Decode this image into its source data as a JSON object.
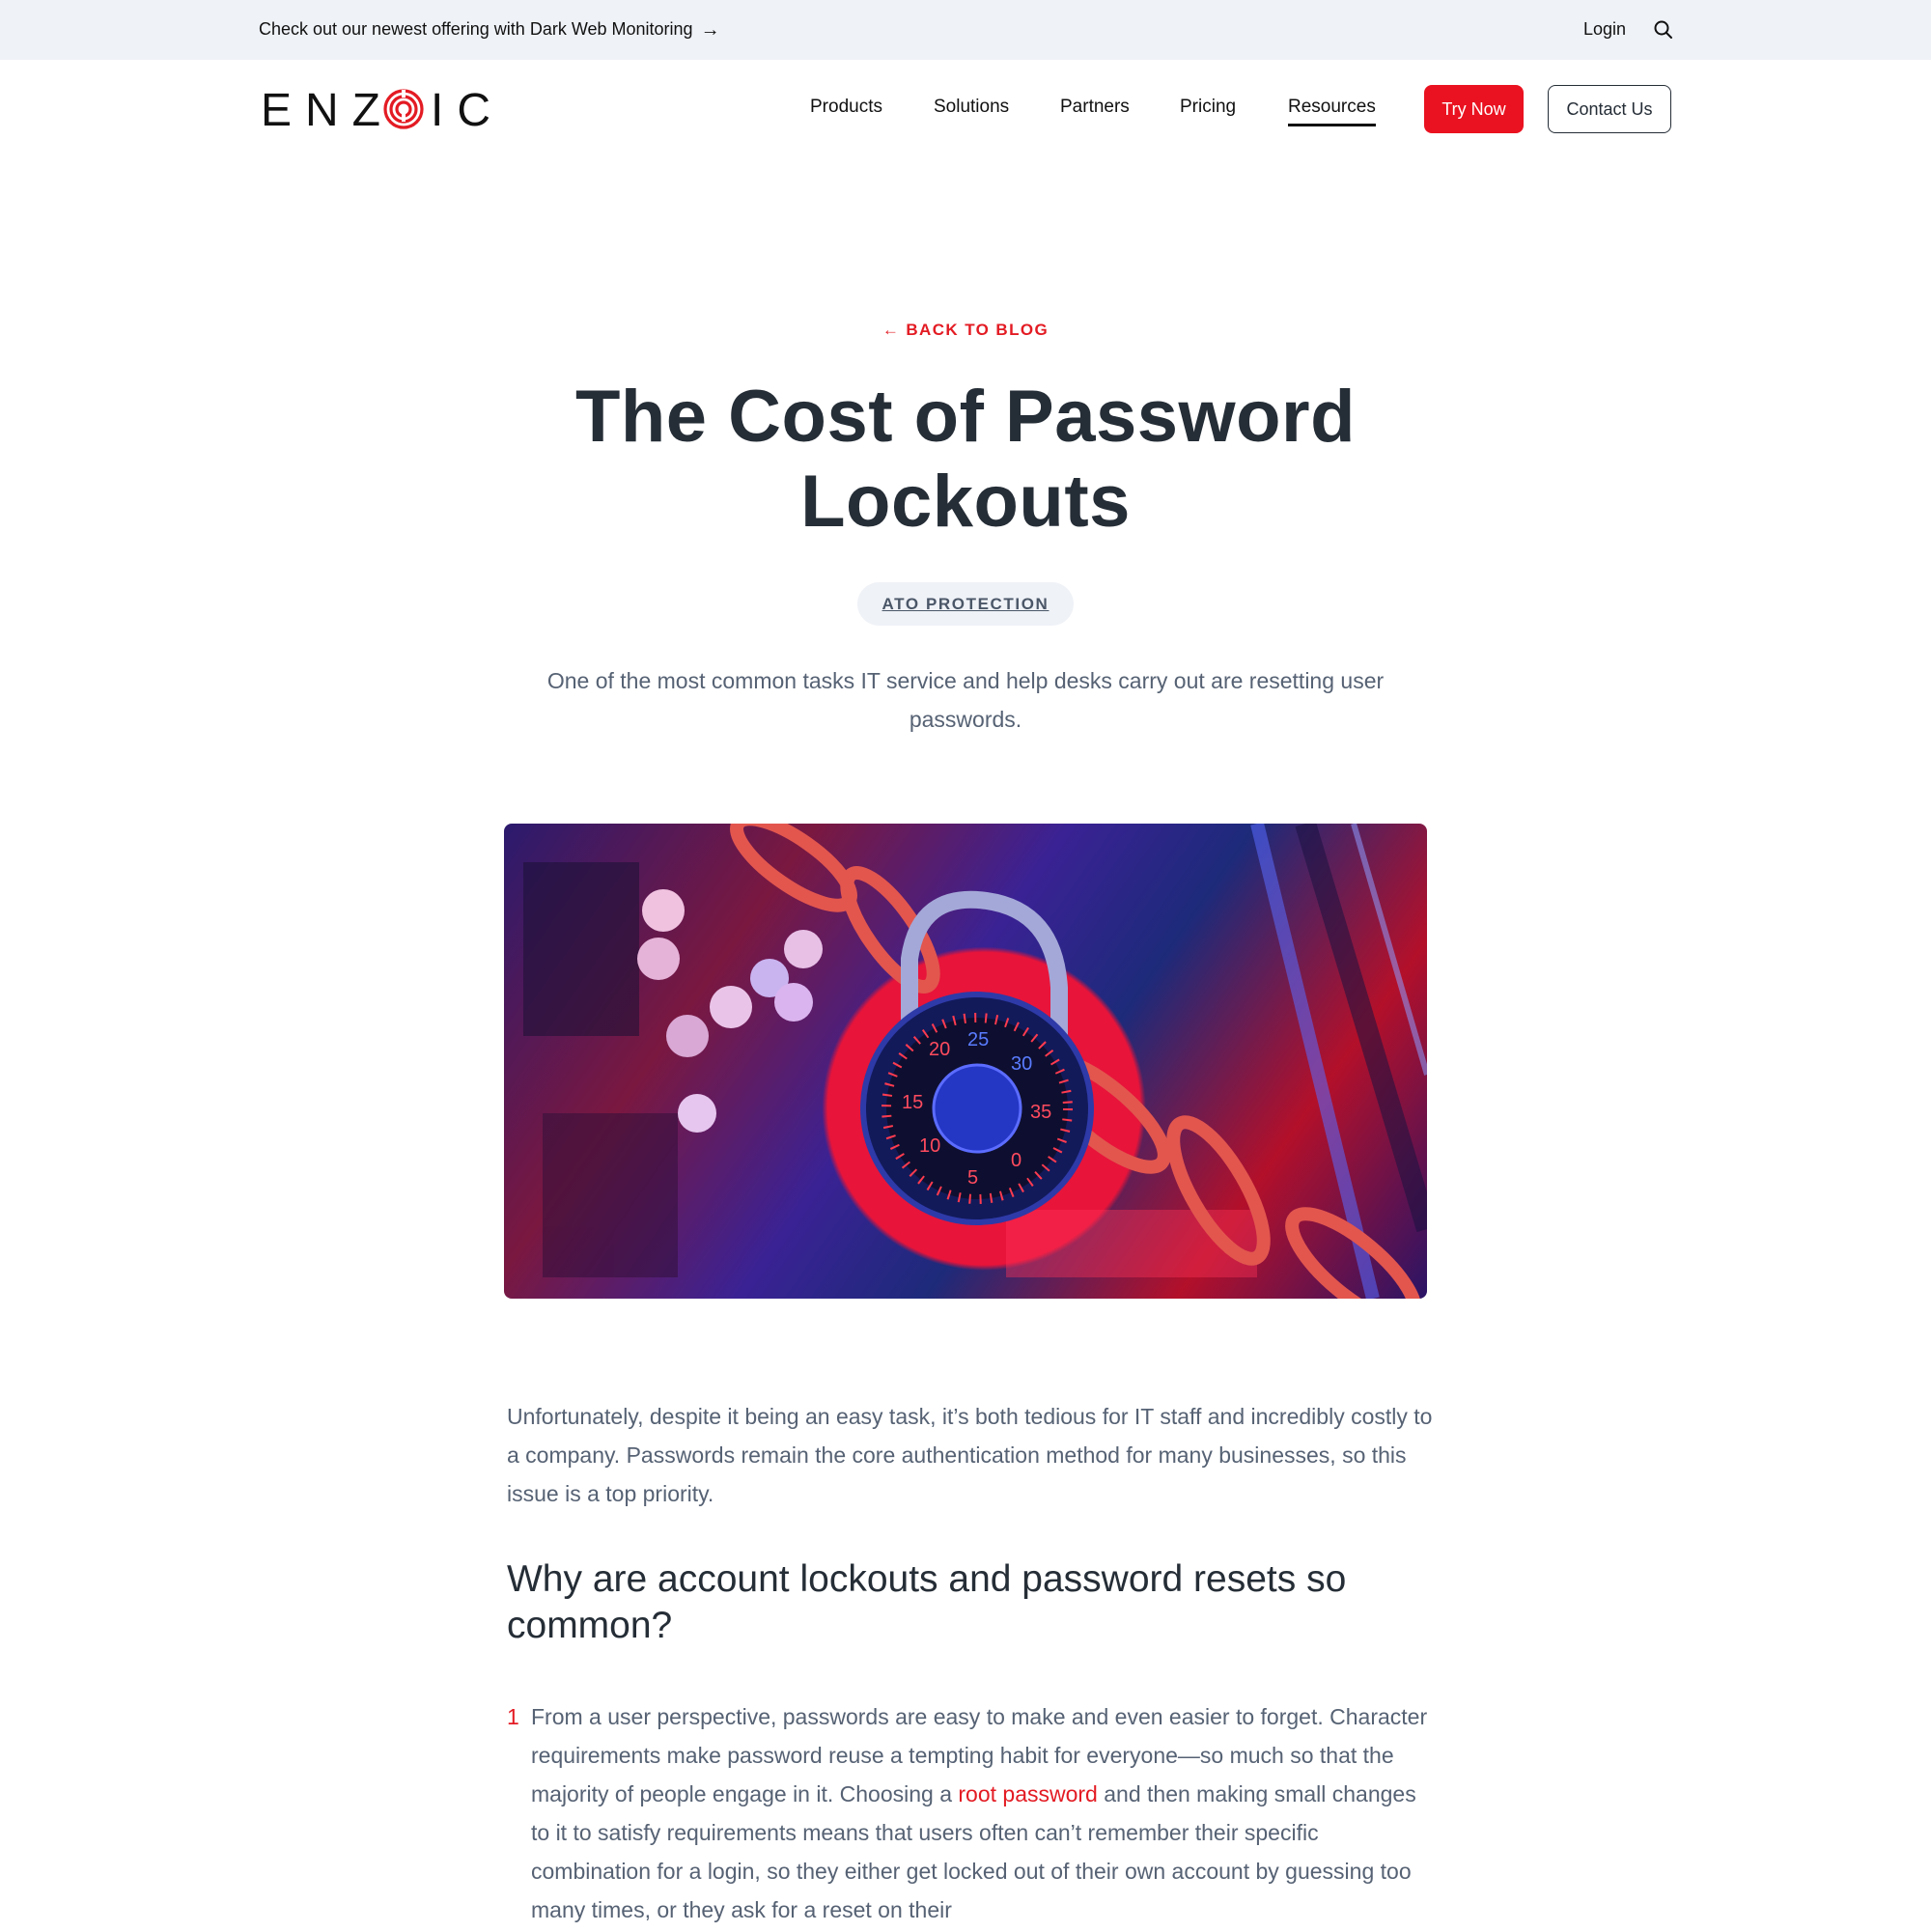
{
  "topbar": {
    "promo_text": "Check out our newest offering with Dark Web Monitoring",
    "promo_arrow": "→",
    "login_label": "Login",
    "search_icon": "search-icon"
  },
  "nav": {
    "logo_text_left": "ENZ",
    "logo_text_right": "IC",
    "links": [
      {
        "label": "Products"
      },
      {
        "label": "Solutions"
      },
      {
        "label": "Partners"
      },
      {
        "label": "Pricing"
      },
      {
        "label": "Resources",
        "active": true
      }
    ],
    "try_now_label": "Try Now",
    "contact_label": "Contact Us"
  },
  "article": {
    "back_arrow": "←",
    "back_label": "BACK TO BLOG",
    "title": "The Cost of Password Lockouts",
    "tag": "ATO PROTECTION",
    "lead": "One of the most common tasks IT service and help desks carry out are resetting user passwords.",
    "hero_image_alt": "Combination padlock and chain on a circuit board lit in red and blue",
    "hero_dial_numbers": [
      "20",
      "25",
      "30",
      "35",
      "0",
      "5",
      "10",
      "15"
    ],
    "paragraph_1": "Unfortunately, despite it being an easy task, it’s both tedious for IT staff and incredibly costly to a company. Passwords remain the core authentication method for many businesses, so this issue is a top priority.",
    "heading_2": "Why are account lockouts and password resets so common?",
    "list": [
      {
        "number": "1",
        "text_before_link": "From a user perspective, passwords are easy to make and even easier to forget. Character requirements make password reuse a tempting habit for everyone—so much so that the majority of people engage in it. Choosing a ",
        "link_text": "root password",
        "text_after_link": " and then making small changes to it to satisfy requirements means that users often can’t remember their specific combination for a login, so they either get locked out of their own account by guessing too many times, or they ask for a reset on their"
      }
    ]
  },
  "colors": {
    "brand_red": "#e31b23",
    "button_red": "#ea1220",
    "heading": "#252d36",
    "body_text": "#566274",
    "topbar_bg": "#eff2f7"
  }
}
